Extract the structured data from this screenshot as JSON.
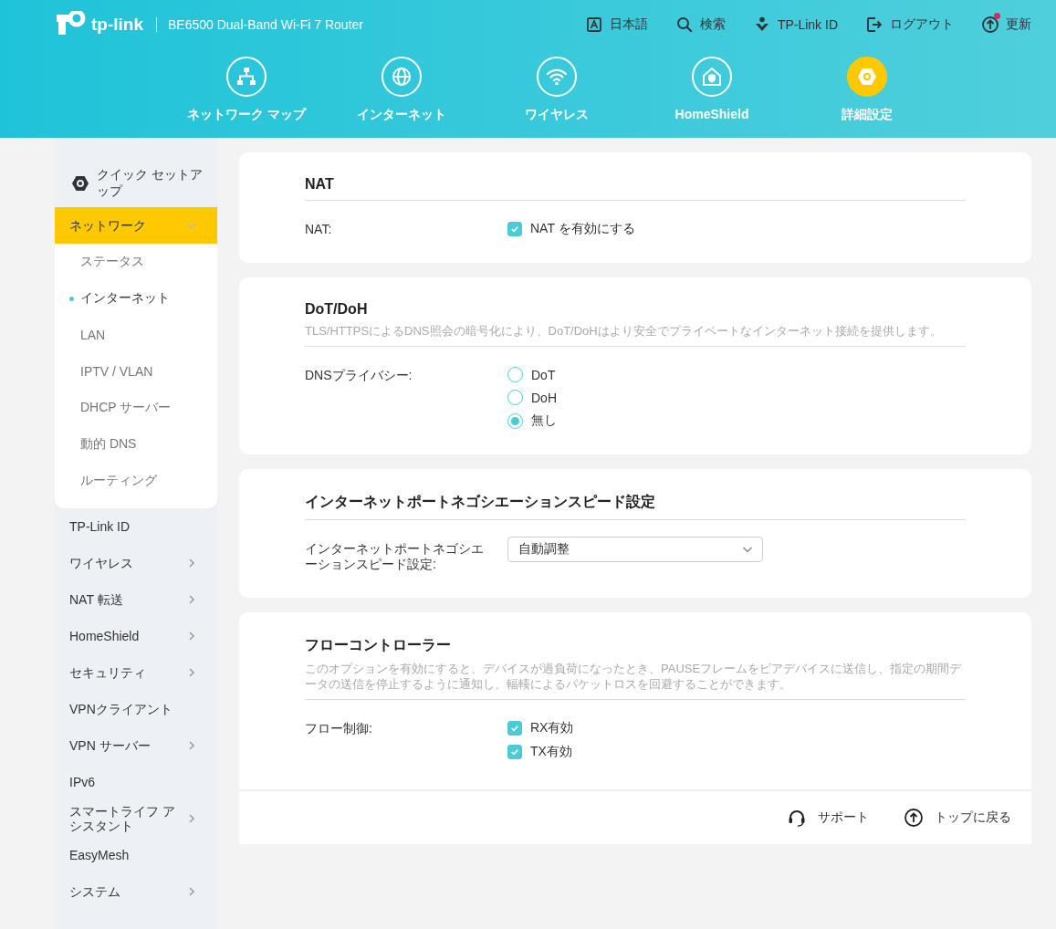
{
  "header": {
    "logo": "tp-link",
    "model": "BE6500 Dual-Band Wi-Fi 7 Router",
    "top_links": [
      {
        "kind": "language",
        "label": "日本語",
        "alert": false
      },
      {
        "kind": "search",
        "label": "検索",
        "alert": false
      },
      {
        "kind": "account",
        "label": "TP-Link ID",
        "alert": false
      },
      {
        "kind": "logout",
        "label": "ログアウト",
        "alert": false
      },
      {
        "kind": "update",
        "label": "更新",
        "alert": true
      }
    ],
    "nav": [
      {
        "kind": "map",
        "label": "ネットワーク マップ",
        "selected": false
      },
      {
        "kind": "internet",
        "label": "インターネット",
        "selected": false
      },
      {
        "kind": "wireless",
        "label": "ワイヤレス",
        "selected": false
      },
      {
        "kind": "shield",
        "label": "HomeShield",
        "selected": false
      },
      {
        "kind": "advanced",
        "label": "詳細設定",
        "selected": true
      }
    ]
  },
  "sidebar": {
    "quick_setup": "クイック セットアップ",
    "items": [
      {
        "label": "ネットワーク",
        "expandable": true,
        "expanded": true,
        "selected": true,
        "children": [
          {
            "label": "ステータス",
            "selected": false
          },
          {
            "label": "インターネット",
            "selected": true
          },
          {
            "label": "LAN",
            "selected": false
          },
          {
            "label": "IPTV / VLAN",
            "selected": false
          },
          {
            "label": "DHCP サーバー",
            "selected": false
          },
          {
            "label": "動的 DNS",
            "selected": false
          },
          {
            "label": "ルーティング",
            "selected": false
          }
        ]
      },
      {
        "label": "TP-Link ID",
        "expandable": false,
        "expanded": false,
        "selected": false
      },
      {
        "label": "ワイヤレス",
        "expandable": true,
        "expanded": false,
        "selected": false
      },
      {
        "label": "NAT 転送",
        "expandable": true,
        "expanded": false,
        "selected": false
      },
      {
        "label": "HomeShield",
        "expandable": true,
        "expanded": false,
        "selected": false
      },
      {
        "label": "セキュリティ",
        "expandable": true,
        "expanded": false,
        "selected": false
      },
      {
        "label": "VPNクライアント",
        "expandable": false,
        "expanded": false,
        "selected": false
      },
      {
        "label": "VPN サーバー",
        "expandable": true,
        "expanded": false,
        "selected": false
      },
      {
        "label": "IPv6",
        "expandable": false,
        "expanded": false,
        "selected": false
      },
      {
        "label": "スマートライフ アシスタント",
        "expandable": true,
        "expanded": false,
        "selected": false
      },
      {
        "label": "EasyMesh",
        "expandable": false,
        "expanded": false,
        "selected": false
      },
      {
        "label": "システム",
        "expandable": true,
        "expanded": false,
        "selected": false
      }
    ]
  },
  "sections": [
    {
      "title": "NAT",
      "fields": [
        {
          "label": "NAT:",
          "kind": "checkbox",
          "options": [
            {
              "label": "NAT を有効にする",
              "checked": true
            }
          ]
        }
      ]
    },
    {
      "title": "DoT/DoH",
      "description": "TLS/HTTPSによるDNS照会の暗号化により、DoT/DoHはより安全でプライベートなインターネット接続を提供します。",
      "fields": [
        {
          "label": "DNSプライバシー:",
          "kind": "radio",
          "options": [
            {
              "label": "DoT",
              "checked": false
            },
            {
              "label": "DoH",
              "checked": false
            },
            {
              "label": "無し",
              "checked": true
            }
          ]
        }
      ]
    },
    {
      "title": "インターネットポートネゴシエーションスピード設定",
      "fields": [
        {
          "label": "インターネットポートネゴシエーションスピード設定:",
          "kind": "select",
          "value": "自動調整"
        }
      ]
    },
    {
      "title": "フローコントローラー",
      "description": "このオプションを有効にすると、デバイスが過負荷になったとき、PAUSEフレームをピアデバイスに送信し、指定の期間データの送信を停止するように通知し、輻輳によるパケットロスを回避することができます。",
      "fields": [
        {
          "label": "フロー制御:",
          "kind": "checkbox",
          "options": [
            {
              "label": "RX有効",
              "checked": true
            },
            {
              "label": "TX有効",
              "checked": true
            }
          ]
        }
      ]
    }
  ],
  "footer": [
    {
      "kind": "support",
      "label": "サポート"
    },
    {
      "kind": "top",
      "label": "トップに戻る"
    }
  ]
}
